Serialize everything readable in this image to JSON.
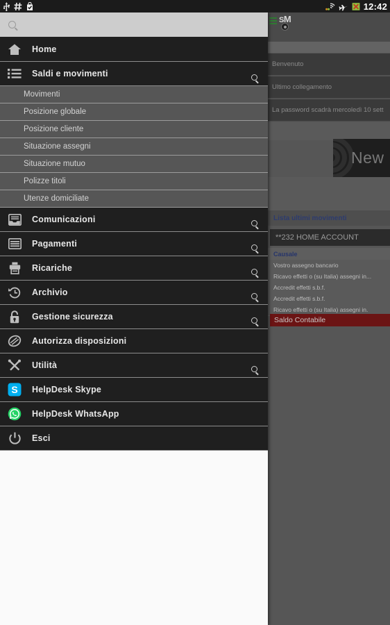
{
  "status_bar": {
    "icons_left": [
      "usb-icon",
      "hash-icon",
      "bag-check-icon"
    ],
    "icons_right": [
      "wifi-icon",
      "airplane-mode-icon",
      "sync-error-icon"
    ],
    "time": "12:42"
  },
  "app": {
    "logo_s": "S",
    "logo_m": "M",
    "rows": [
      {
        "label": "Benvenuto"
      },
      {
        "label": "Ultimo collegamento"
      },
      {
        "label": "La password scadrà mercoledì 10 sett"
      }
    ],
    "promo": {
      "text": "New"
    },
    "list_title": "Lista ultimi movimenti",
    "account": "**232 HOME ACCOUNT",
    "column_header": "Causale",
    "transactions": [
      "Vostro assegno bancario",
      "Ricavo effetti o (su Italia) assegni in...",
      "Accredit effetti s.b.f.",
      "Accredit effetti s.b.f.",
      "Ricavo effetti o (su Italia) assegni in."
    ],
    "balance_label": "Saldo Contabile",
    "accent_blue": "#26356b",
    "balance_red": "#6b1414"
  },
  "drawer": {
    "search": {
      "value": "",
      "placeholder": ""
    },
    "menu": [
      {
        "label": "Home",
        "icon": "home-icon",
        "badge": false
      },
      {
        "label": "Saldi e movimenti",
        "icon": "list-icon",
        "badge": true
      },
      {
        "label": "Comunicazioni",
        "icon": "inbox-icon",
        "badge": true
      },
      {
        "label": "Pagamenti",
        "icon": "payments-icon",
        "badge": true
      },
      {
        "label": "Ricariche",
        "icon": "topup-icon",
        "badge": true
      },
      {
        "label": "Archivio",
        "icon": "history-icon",
        "badge": true
      },
      {
        "label": "Gestione sicurezza",
        "icon": "lock-icon",
        "badge": true
      },
      {
        "label": "Autorizza disposizioni",
        "icon": "authorize-icon",
        "badge": false
      },
      {
        "label": "Utilità",
        "icon": "tools-icon",
        "badge": true
      },
      {
        "label": "HelpDesk Skype",
        "icon": "skype-icon",
        "badge": false
      },
      {
        "label": "HelpDesk WhatsApp",
        "icon": "whatsapp-icon",
        "badge": false
      },
      {
        "label": "Esci",
        "icon": "power-icon",
        "badge": false
      }
    ],
    "submenu": [
      {
        "label": "Movimenti"
      },
      {
        "label": "Posizione globale"
      },
      {
        "label": "Posizione cliente"
      },
      {
        "label": "Situazione assegni"
      },
      {
        "label": "Situazione mutuo"
      },
      {
        "label": "Polizze titoli"
      },
      {
        "label": "Utenze domiciliate"
      }
    ]
  }
}
